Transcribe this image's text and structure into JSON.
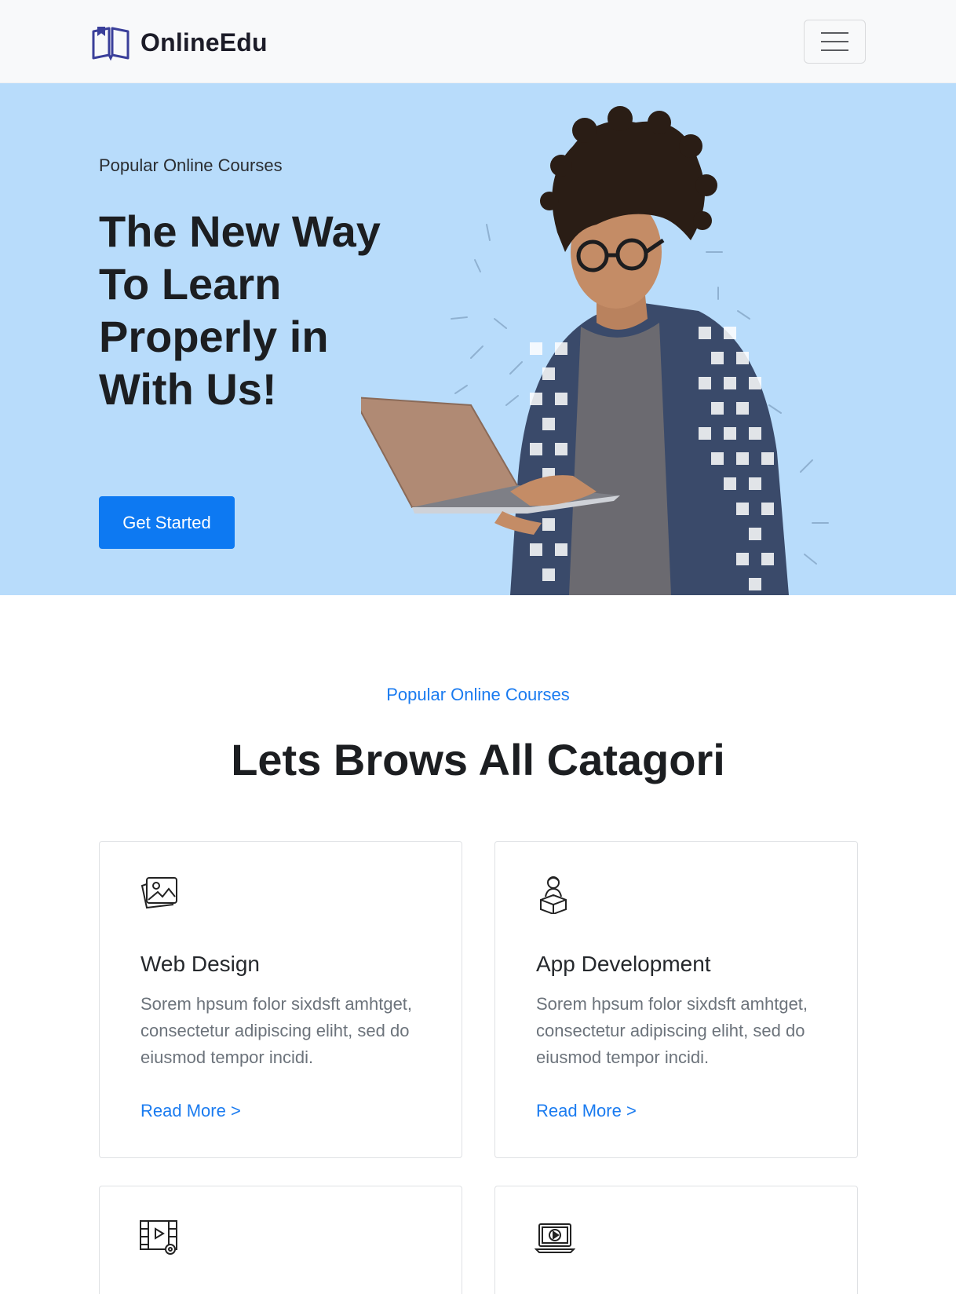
{
  "nav": {
    "brand": "OnlineEdu"
  },
  "hero": {
    "subtitle": "Popular Online Courses",
    "title": "The New Way To Learn Properly in With Us!",
    "cta": "Get Started"
  },
  "section": {
    "subtitle": "Popular Online Courses",
    "title": "Lets Brows All Catagori"
  },
  "cards": [
    {
      "title": "Web Design",
      "text": "Sorem hpsum folor sixdsft amhtget, consectetur adipiscing eliht, sed do eiusmod tempor incidi.",
      "link": "Read More >",
      "icon": "image-gallery-icon"
    },
    {
      "title": "App Development",
      "text": "Sorem hpsum folor sixdsft amhtget, consectetur adipiscing eliht, sed do eiusmod tempor incidi.",
      "link": "Read More >",
      "icon": "developer-box-icon"
    },
    {
      "icon": "video-settings-icon"
    },
    {
      "icon": "laptop-play-icon"
    }
  ],
  "colors": {
    "hero_bg": "#b8dcfb",
    "primary": "#0d79f2",
    "link": "#1a7bf0"
  }
}
